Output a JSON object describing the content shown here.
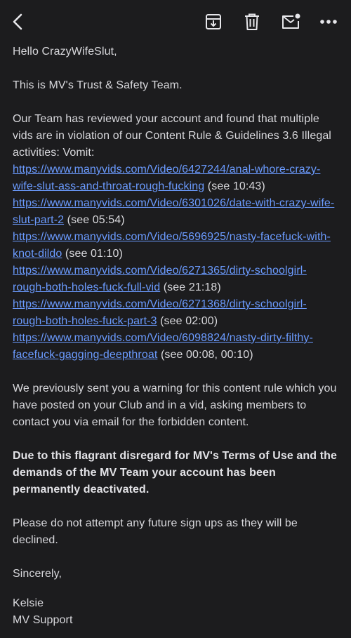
{
  "greeting": "Hello CrazyWifeSlut,",
  "intro": "This is MV's Trust & Safety Team.",
  "review_text": "Our Team has reviewed your account and found that multiple vids are in violation of our Content Rule & Guidelines 3.6 Illegal activities: Vomit:",
  "violations": [
    {
      "url": "https://www.manyvids.com/Video/6427244/anal-whore-crazy-wife-slut-ass-and-throat-rough-fucking",
      "note": " (see 10:43)"
    },
    {
      "url": "https://www.manyvids.com/Video/6301026/date-with-crazy-wife-slut-part-2",
      "note": " (see 05:54)"
    },
    {
      "url": "https://www.manyvids.com/Video/5696925/nasty-facefuck-with-knot-dildo",
      "note": " (see 01:10)"
    },
    {
      "url": "https://www.manyvids.com/Video/6271365/dirty-schoolgirl-rough-both-holes-fuck-full-vid",
      "note": " (see 21:18)"
    },
    {
      "url": "https://www.manyvids.com/Video/6271368/dirty-schoolgirl-rough-both-holes-fuck-part-3",
      "note": " (see 02:00)"
    },
    {
      "url": "https://www.manyvids.com/Video/6098824/nasty-dirty-filthy-facefuck-gagging-deepthroat",
      "note": " (see 00:08, 00:10)"
    }
  ],
  "warning_text": "We previously sent you a warning for this content rule which you have posted on your Club and in a vid, asking members to contact you via email for the forbidden content.",
  "deactivation_text": "Due to this flagrant disregard for MV's Terms of Use and the demands of the MV Team your account has been permanently deactivated.",
  "signup_text": "Please do not attempt any future sign ups as they will be declined.",
  "closing": "Sincerely,",
  "signature_name": "Kelsie",
  "signature_team": "MV Support",
  "icons": {
    "back": "chevron-left-icon",
    "archive": "archive-icon",
    "delete": "trash-icon",
    "unread": "mail-unread-icon",
    "more": "more-icon"
  },
  "colors": {
    "background": "#1c1c1e",
    "text": "#d8d8dc",
    "link": "#6b9bff"
  }
}
